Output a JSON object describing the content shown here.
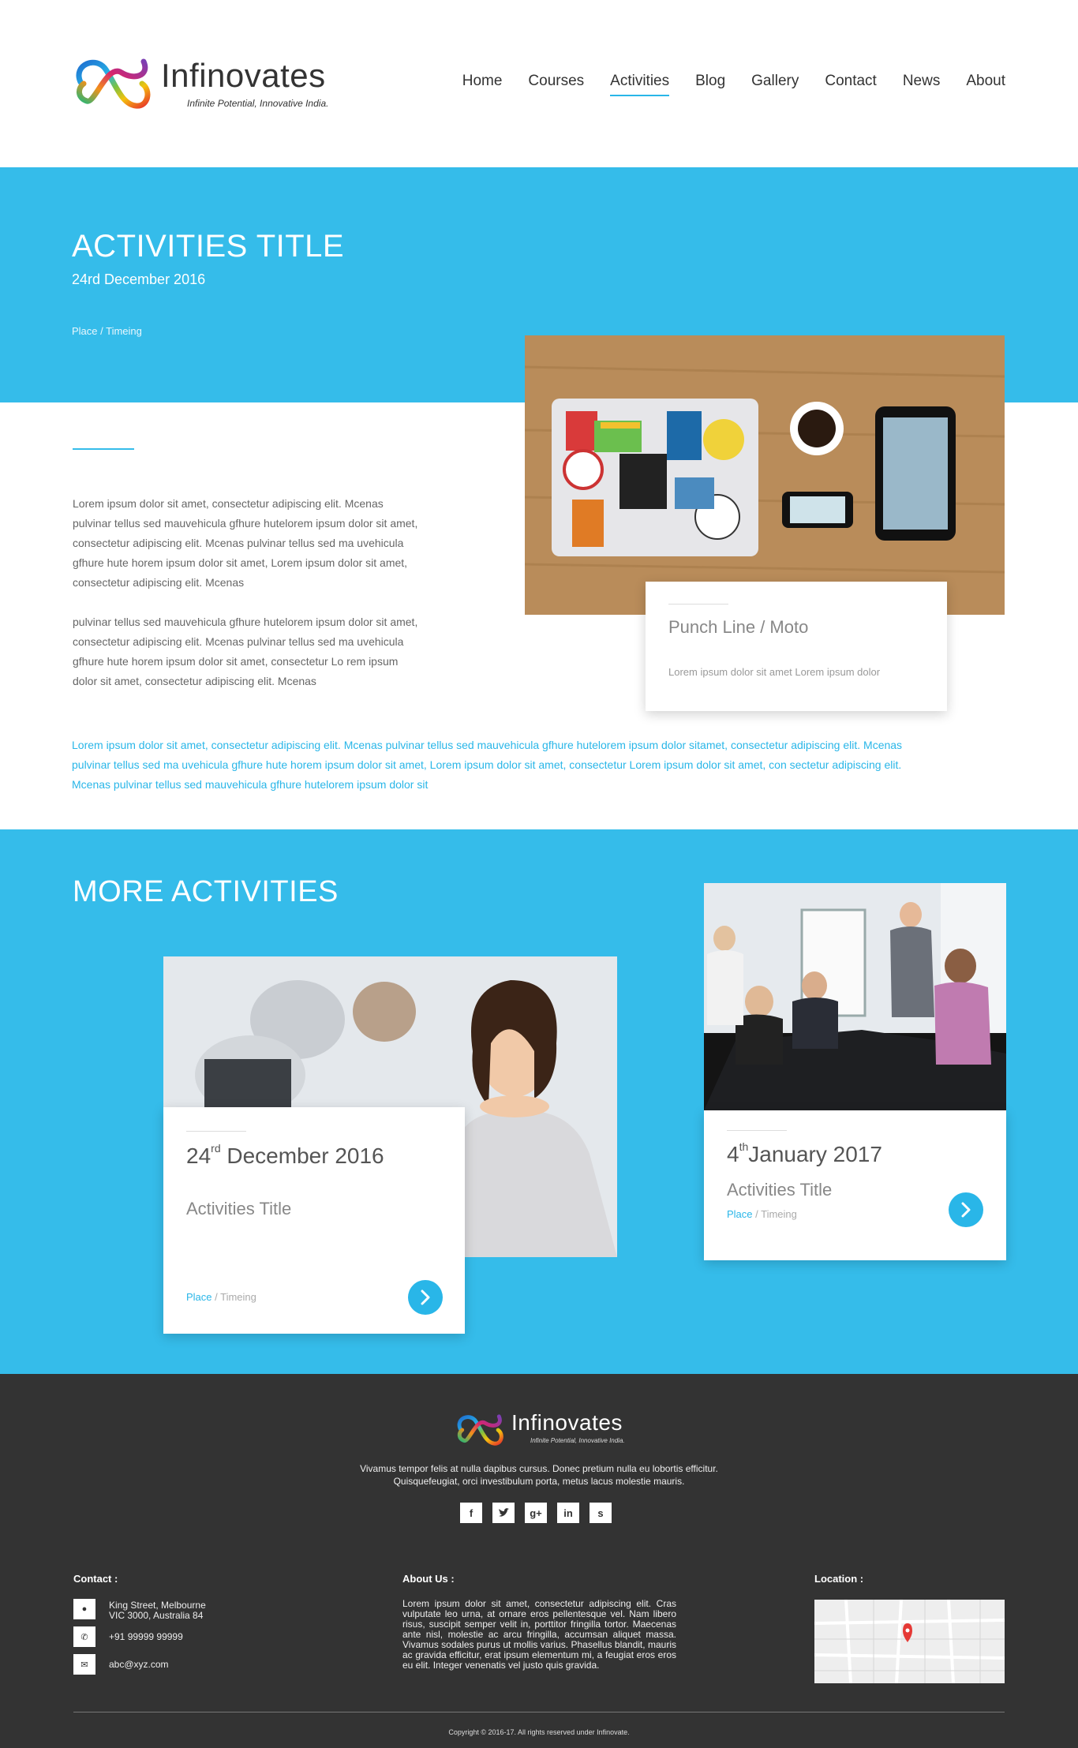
{
  "brand": {
    "name": "Infinovates",
    "tagline": "Infinite Potential, Innovative India."
  },
  "nav": {
    "items": [
      {
        "label": "Home"
      },
      {
        "label": "Courses"
      },
      {
        "label": "Activities"
      },
      {
        "label": "Blog"
      },
      {
        "label": "Gallery"
      },
      {
        "label": "Contact"
      },
      {
        "label": "News"
      },
      {
        "label": "About"
      }
    ],
    "active": "Activities"
  },
  "hero": {
    "title": "ACTIVITIES TITLE",
    "date": "24rd December 2016",
    "place_timing": "Place / Timeing"
  },
  "punch": {
    "title": "Punch Line / Moto",
    "subtitle": "Lorem ipsum dolor sit amet Lorem ipsum dolor"
  },
  "body": {
    "para1": "Lorem ipsum dolor sit amet, consectetur adipiscing  elit. Mcenas pulvinar tellus sed mauvehicula gfhure hutelorem ipsum dolor sit amet, consectetur adipiscing  elit. Mcenas pulvinar tellus sed ma uvehicula gfhure hute horem ipsum dolor sit amet, Lorem ipsum dolor sit amet, consectetur adipiscing  elit. Mcenas",
    "para2": "pulvinar tellus sed mauvehicula gfhure hutelorem ipsum dolor sit amet, consectetur adipiscing  elit. Mcenas pulvinar tellus sed ma uvehicula gfhure hute horem ipsum dolor sit amet, consectetur Lo rem ipsum dolor sit amet, consectetur adipiscing  elit. Mcenas",
    "highlight": "Lorem ipsum dolor sit amet, consectetur adipiscing  elit. Mcenas pulvinar tellus sed mauvehicula gfhure hutelorem ipsum dolor sitamet, consectetur adipiscing  elit. Mcenas pulvinar tellus sed ma uvehicula gfhure hute horem ipsum dolor sit amet, Lorem ipsum dolor sit amet, consectetur Lorem ipsum dolor sit amet, con sectetur adipiscing  elit. Mcenas pulvinar tellus sed mauvehicula gfhure hutelorem ipsum dolor sit"
  },
  "more": {
    "title": "MORE ACTIVITIES",
    "cards": [
      {
        "day": "24",
        "suffix": "rd",
        "month_year": " December 2016",
        "title": "Activities Title",
        "place": "Place",
        "timing": " / Timeing"
      },
      {
        "day": "4",
        "suffix": "th",
        "month_year": "January 2017",
        "title": "Activities Title",
        "place": "Place",
        "timing": " / Timeing"
      }
    ]
  },
  "footer": {
    "tagline_line1": "Vivamus tempor felis at nulla dapibus cursus. Donec pretium nulla eu lobortis efficitur.",
    "tagline_line2": "Quisquefeugiat, orci investibulum porta, metus lacus molestie mauris.",
    "social": [
      "f",
      "t",
      "g+",
      "in",
      "s"
    ],
    "contact_heading": "Contact :",
    "address_line1": "King Street, Melbourne",
    "address_line2": "VIC 3000, Australia 84",
    "phone": "+91 99999 99999",
    "email": "abc@xyz.com",
    "about_heading": "About Us :",
    "about_text": "Lorem ipsum dolor sit amet, consectetur adipiscing elit. Cras vulputate leo urna, at ornare eros pellentesque vel. Nam libero risus, suscipit semper velit in, porttitor fringilla tortor. Maecenas ante nisl, molestie ac arcu fringilla, accumsan aliquet massa. Vivamus sodales purus ut mollis varius. Phasellus blandit, mauris ac gravida efficitur, erat ipsum elementum mi, a feugiat eros eros eu elit. Integer venenatis vel justo quis gravida.",
    "location_heading": "Location :",
    "copyright": "Copyright © 2016-17. All rights reserved under Infinovate."
  },
  "colors": {
    "accent": "#35bcea",
    "link": "#29b6e8",
    "footer_bg": "#333333"
  }
}
